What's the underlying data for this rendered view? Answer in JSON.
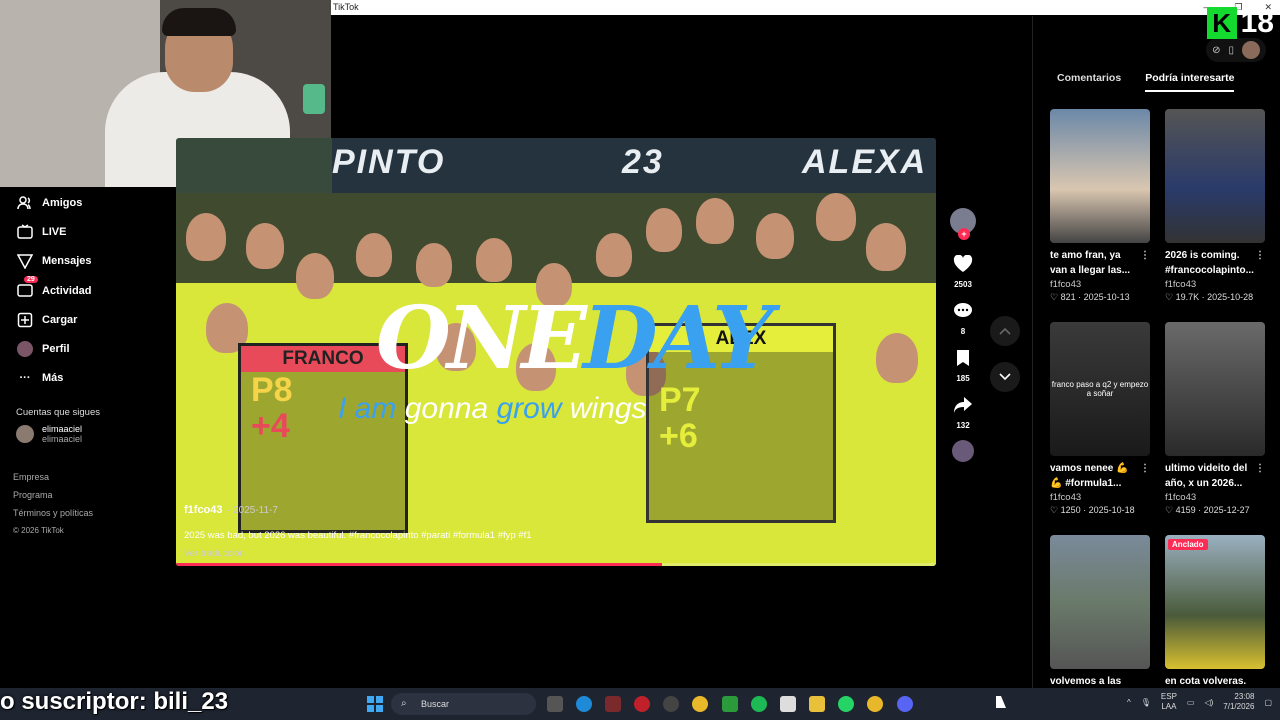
{
  "window": {
    "title": "TikTok"
  },
  "sidebar": {
    "items": [
      {
        "label": "Amigos",
        "icon": "friends-icon"
      },
      {
        "label": "LIVE",
        "icon": "live-icon"
      },
      {
        "label": "Mensajes",
        "icon": "messages-icon"
      },
      {
        "label": "Actividad",
        "icon": "activity-icon",
        "badge": "29"
      },
      {
        "label": "Cargar",
        "icon": "upload-icon"
      },
      {
        "label": "Perfil",
        "icon": "profile-avatar"
      },
      {
        "label": "Más",
        "icon": "more-icon"
      }
    ],
    "following_title": "Cuentas que sigues",
    "following": [
      {
        "name": "elimaaciel",
        "handle": "elimaaciel"
      }
    ],
    "footer": [
      "Empresa",
      "Programa",
      "Términos y políticas"
    ],
    "copyright": "© 2026 TikTok"
  },
  "video": {
    "signs": [
      "PINTO",
      "23",
      "ALEXA"
    ],
    "board_left": {
      "header": "FRANCO",
      "pos": "P8",
      "delta": "+4"
    },
    "board_right": {
      "header": "ALEX",
      "pos": "P7",
      "delta": "+6"
    },
    "overlay_line1_a": "ONE",
    "overlay_line1_b": "DAY",
    "overlay_line2_a": "I am",
    "overlay_line2_b": "gonna",
    "overlay_line2_c": "grow",
    "overlay_line2_d": "wings",
    "author": "f1fco43",
    "date": "· 2025-11-7",
    "description": "2025 was bad, but 2026 was beautiful. #francocolapinto #parati #formula1 #fyp #f1",
    "translate": "Ver traducción",
    "progress": 0.64
  },
  "actions": {
    "likes": "2503",
    "comments": "8",
    "saves": "185",
    "shares": "132"
  },
  "right_panel": {
    "tabs": [
      "Comentarios",
      "Podría interesarte"
    ],
    "active_tab": 1,
    "cards": [
      {
        "title": "te amo fran, ya van a llegar las...",
        "author": "f1fco43",
        "stats": "♡ 821 · 2025-10-13"
      },
      {
        "title": "2026 is coming. #francocolapinto...",
        "author": "f1fco43",
        "stats": "♡ 19.7K · 2025-10-28"
      },
      {
        "title": "vamos nenee 💪 💪 #formula1...",
        "author": "f1fco43",
        "stats": "♡ 1250 · 2025-10-18",
        "overlay": "franco paso a q2 y empezo a soñar"
      },
      {
        "title": "ultimo videito del año, x un 2026...",
        "author": "f1fco43",
        "stats": "♡ 4159 · 2025-12-27"
      },
      {
        "title": "volvemos a las",
        "author": "",
        "stats": ""
      },
      {
        "title": "en cota volveras.",
        "author": "",
        "stats": "",
        "pinned": "Anclado"
      }
    ]
  },
  "logo": {
    "letter": "K",
    "number": "18"
  },
  "stream_subtitle": "o suscriptor: bili_23",
  "taskbar": {
    "search_placeholder": "Buscar",
    "lang": "ESP",
    "lang2": "LAA",
    "time": "23:08",
    "date": "7/1/2026"
  },
  "colors": {
    "accent": "#fe2c55",
    "brand_k18": "#14d92e",
    "overlay_blue": "#3aa0f0"
  }
}
